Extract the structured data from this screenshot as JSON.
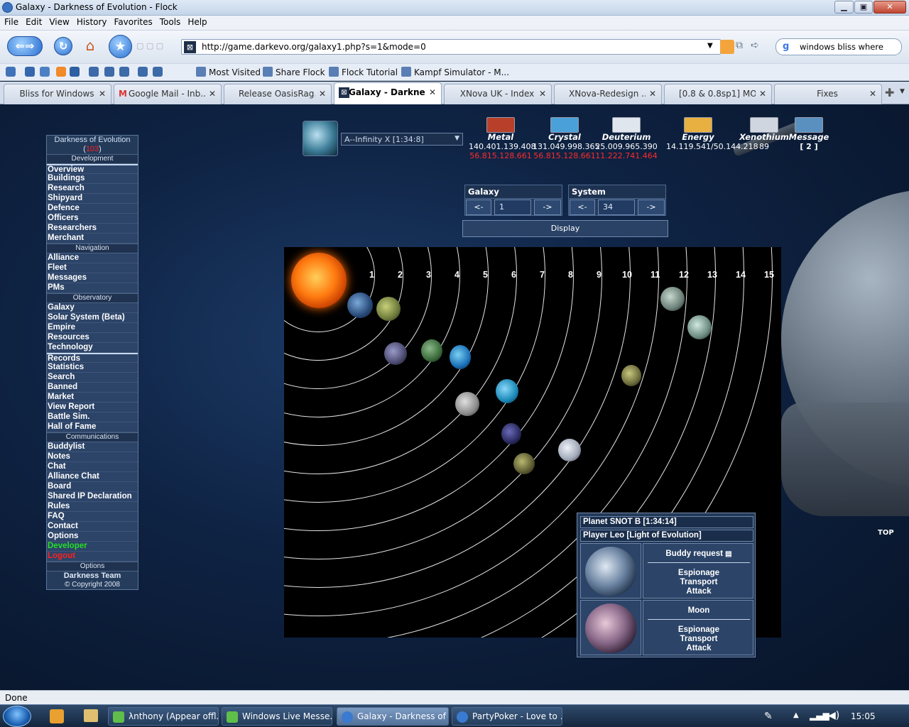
{
  "window": {
    "title": "Galaxy - Darkness of Evolution - Flock"
  },
  "menu": [
    "File",
    "Edit",
    "View",
    "History",
    "Favorites",
    "Tools",
    "Help"
  ],
  "address": {
    "url": "http://game.darkevo.org/galaxy1.php?s=1&mode=0"
  },
  "search": {
    "value": "windows bliss where"
  },
  "bookmarks": [
    "Most Visited",
    "Share Flock",
    "Flock Tutorial",
    "Kampf Simulator - M..."
  ],
  "tabs": [
    {
      "label": "Bliss for Windows",
      "active": false
    },
    {
      "label": "Google Mail - Inb...",
      "active": false
    },
    {
      "label": "Release OasisRag...",
      "active": false
    },
    {
      "label": "Galaxy - Darkne...",
      "active": true
    },
    {
      "label": "XNova UK - Index",
      "active": false
    },
    {
      "label": "XNova-Redesign ...",
      "active": false
    },
    {
      "label": "[0.8 & 0.8sp1] MO...",
      "active": false
    },
    {
      "label": "Fixes",
      "active": false
    }
  ],
  "game": {
    "title": "Darkness of Evolution",
    "version": "103",
    "sections": {
      "development": "Development",
      "navigation": "Navigation",
      "observatory": "Observatory",
      "communications": "Communications",
      "options": "Options"
    },
    "dev_items": [
      "Overview",
      "Buildings",
      "Research",
      "Shipyard",
      "Defence",
      "Officers",
      "Researchers",
      "Merchant"
    ],
    "nav_items": [
      "Alliance",
      "Fleet",
      "Messages",
      "PMs"
    ],
    "obs_items": [
      "Galaxy",
      "Solar System (Beta)",
      "Empire",
      "Resources",
      "Technology"
    ],
    "misc_items": [
      "Records",
      "Statistics",
      "Search",
      "Banned",
      "Market",
      "View Report",
      "Battle Sim.",
      "Hall of Fame"
    ],
    "comm_items": [
      "Buddylist",
      "Notes",
      "Chat",
      "Alliance Chat",
      "Board",
      "Shared IP Declaration",
      "Rules",
      "FAQ",
      "Contact",
      "Options",
      "Developer",
      "Logout"
    ],
    "team": "Darkness Team",
    "copyright": "© Copyright 2008",
    "planet_select": "A--Infinity X [1:34:8]",
    "resources": [
      {
        "name": "Metal",
        "amount": "140.401.139.408",
        "prod": "56.815.128.661"
      },
      {
        "name": "Crystal",
        "amount": "131.049.998.365",
        "prod": "56.815.128.661"
      },
      {
        "name": "Deuterium",
        "amount": "25.009.965.390",
        "prod": "11.222.741.464"
      },
      {
        "name": "Energy",
        "amount": "14.119.541/50.144.218",
        "prod": ""
      },
      {
        "name": "Xenothium",
        "amount": "89",
        "prod": ""
      },
      {
        "name": "Message",
        "amount": "[ 2 ]",
        "prod": ""
      }
    ],
    "galaxy_nav": {
      "galaxy_label": "Galaxy",
      "galaxy_value": "1",
      "system_label": "System",
      "system_value": "34",
      "prev": "<-",
      "next": "->",
      "display": "Display"
    },
    "orbits": [
      "1",
      "2",
      "3",
      "4",
      "5",
      "6",
      "7",
      "8",
      "9",
      "10",
      "11",
      "12",
      "13",
      "14",
      "15"
    ],
    "popup": {
      "planet": "Planet SNOT B [1:34:14]",
      "player": "Player Leo [Light of Evolution]",
      "buddy": "Buddy request",
      "actions": [
        "Espionage",
        "Transport",
        "Attack"
      ],
      "moon": "Moon",
      "moon_actions": [
        "Espionage",
        "Transport",
        "Attack"
      ]
    },
    "top_link": "TOP"
  },
  "status": "Done",
  "taskbar": {
    "items": [
      {
        "label": "λnthony (Appear offl...",
        "active": false
      },
      {
        "label": "Windows Live Messe...",
        "active": false
      },
      {
        "label": "Galaxy - Darkness of ...",
        "active": true
      },
      {
        "label": "PartyPoker - Love to ...",
        "active": false
      }
    ],
    "clock": "15:05"
  }
}
